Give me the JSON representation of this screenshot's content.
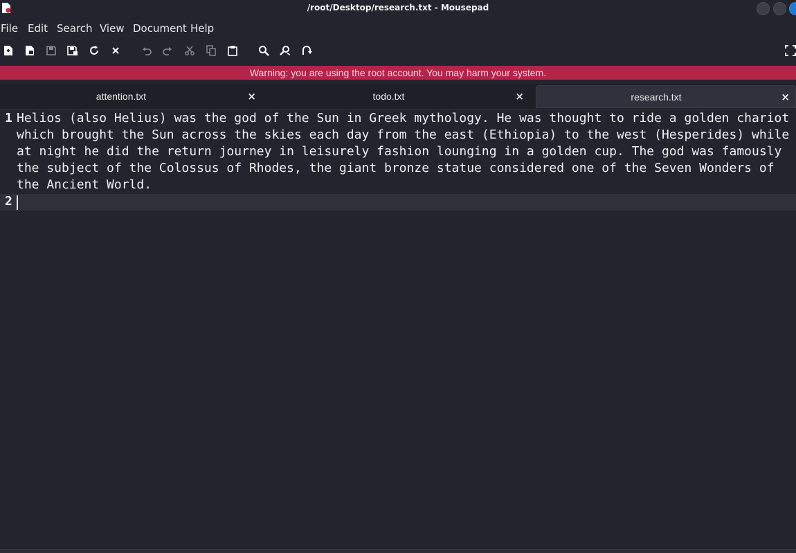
{
  "window": {
    "title": "/root/Desktop/research.txt - Mousepad"
  },
  "menu": {
    "items": [
      "File",
      "Edit",
      "Search",
      "View",
      "Document",
      "Help"
    ]
  },
  "toolbar": {
    "icons": [
      "new-document-icon",
      "new-window-icon",
      "save-icon",
      "save-as-icon",
      "reload-icon",
      "close-document-icon",
      "undo-icon",
      "redo-icon",
      "cut-icon",
      "copy-icon",
      "paste-icon",
      "find-icon",
      "find-replace-icon",
      "go-to-line-icon",
      "fullscreen-icon"
    ]
  },
  "warning": {
    "text": "Warning: you are using the root account. You may harm your system."
  },
  "tabs": [
    {
      "label": "attention.txt",
      "close": "×"
    },
    {
      "label": "todo.txt",
      "close": "×"
    },
    {
      "label": "research.txt",
      "close": "×"
    }
  ],
  "editor": {
    "line_numbers": [
      "1",
      "2"
    ],
    "line1_wrapped": [
      "Helios (also Helius) was the god of the Sun in Greek mythology. He was thought to ride a golden chariot",
      "which brought the Sun across the skies each day from the east (Ethiopia) to the west (Hesperides) while",
      "at night he did the return journey in leisurely fashion lounging in a golden cup. The god was famously",
      "the subject of the Colossus of Rhodes, the giant bronze statue considered one of the Seven Wonders of",
      "the Ancient World."
    ],
    "line2": ""
  },
  "colors": {
    "background": "#23252e",
    "warning": "#b52448",
    "accent": "#2277d8"
  }
}
